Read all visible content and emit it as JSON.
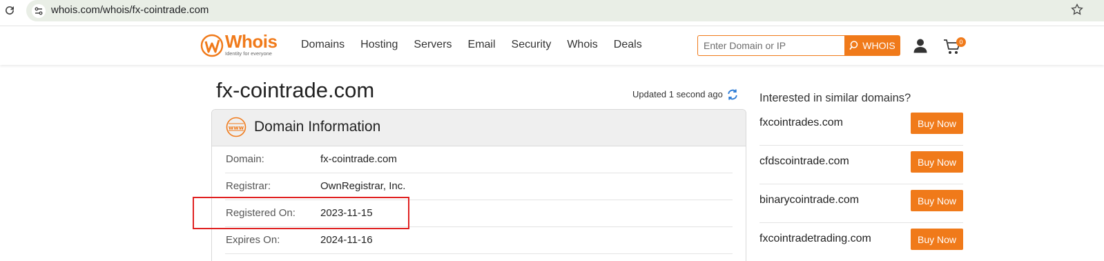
{
  "browser": {
    "url": "whois.com/whois/fx-cointrade.com",
    "icons": [
      "reload-icon",
      "site-info-icon",
      "bookmark-star-icon"
    ]
  },
  "header": {
    "logo_text": "Whois",
    "logo_tagline": "Identity for everyone",
    "nav": [
      "Domains",
      "Hosting",
      "Servers",
      "Email",
      "Security",
      "Whois",
      "Deals"
    ],
    "search": {
      "placeholder": "Enter Domain or IP",
      "button_label": "WHOIS"
    },
    "cart_count": "0",
    "accent_color": "#f07a1a"
  },
  "page": {
    "domain_title": "fx-cointrade.com",
    "updated_text": "Updated 1 second ago"
  },
  "domain_info": {
    "title": "Domain Information",
    "rows": [
      {
        "label": "Domain:",
        "value": "fx-cointrade.com"
      },
      {
        "label": "Registrar:",
        "value": "OwnRegistrar, Inc."
      },
      {
        "label": "Registered On:",
        "value": "2023-11-15"
      },
      {
        "label": "Expires On:",
        "value": "2024-11-16"
      }
    ],
    "highlighted_row": "Registered On:",
    "highlight_color": "#e02020"
  },
  "similar": {
    "title": "Interested in similar domains?",
    "buy_label": "Buy Now",
    "domains": [
      "fxcointrades.com",
      "cfdscointrade.com",
      "binarycointrade.com",
      "fxcointradetrading.com"
    ]
  }
}
